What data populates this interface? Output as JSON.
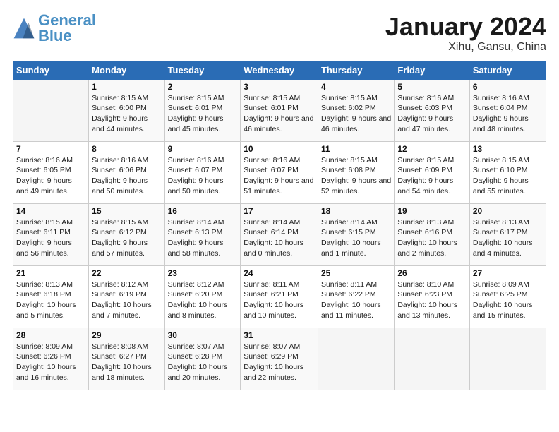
{
  "header": {
    "logo_text_general": "General",
    "logo_text_blue": "Blue",
    "month_title": "January 2024",
    "location": "Xihu, Gansu, China"
  },
  "weekdays": [
    "Sunday",
    "Monday",
    "Tuesday",
    "Wednesday",
    "Thursday",
    "Friday",
    "Saturday"
  ],
  "weeks": [
    [
      {
        "day": "",
        "sunrise": "",
        "sunset": "",
        "daylight": ""
      },
      {
        "day": "1",
        "sunrise": "Sunrise: 8:15 AM",
        "sunset": "Sunset: 6:00 PM",
        "daylight": "Daylight: 9 hours and 44 minutes."
      },
      {
        "day": "2",
        "sunrise": "Sunrise: 8:15 AM",
        "sunset": "Sunset: 6:01 PM",
        "daylight": "Daylight: 9 hours and 45 minutes."
      },
      {
        "day": "3",
        "sunrise": "Sunrise: 8:15 AM",
        "sunset": "Sunset: 6:01 PM",
        "daylight": "Daylight: 9 hours and 46 minutes."
      },
      {
        "day": "4",
        "sunrise": "Sunrise: 8:15 AM",
        "sunset": "Sunset: 6:02 PM",
        "daylight": "Daylight: 9 hours and 46 minutes."
      },
      {
        "day": "5",
        "sunrise": "Sunrise: 8:16 AM",
        "sunset": "Sunset: 6:03 PM",
        "daylight": "Daylight: 9 hours and 47 minutes."
      },
      {
        "day": "6",
        "sunrise": "Sunrise: 8:16 AM",
        "sunset": "Sunset: 6:04 PM",
        "daylight": "Daylight: 9 hours and 48 minutes."
      }
    ],
    [
      {
        "day": "7",
        "sunrise": "Sunrise: 8:16 AM",
        "sunset": "Sunset: 6:05 PM",
        "daylight": "Daylight: 9 hours and 49 minutes."
      },
      {
        "day": "8",
        "sunrise": "Sunrise: 8:16 AM",
        "sunset": "Sunset: 6:06 PM",
        "daylight": "Daylight: 9 hours and 50 minutes."
      },
      {
        "day": "9",
        "sunrise": "Sunrise: 8:16 AM",
        "sunset": "Sunset: 6:07 PM",
        "daylight": "Daylight: 9 hours and 50 minutes."
      },
      {
        "day": "10",
        "sunrise": "Sunrise: 8:16 AM",
        "sunset": "Sunset: 6:07 PM",
        "daylight": "Daylight: 9 hours and 51 minutes."
      },
      {
        "day": "11",
        "sunrise": "Sunrise: 8:15 AM",
        "sunset": "Sunset: 6:08 PM",
        "daylight": "Daylight: 9 hours and 52 minutes."
      },
      {
        "day": "12",
        "sunrise": "Sunrise: 8:15 AM",
        "sunset": "Sunset: 6:09 PM",
        "daylight": "Daylight: 9 hours and 54 minutes."
      },
      {
        "day": "13",
        "sunrise": "Sunrise: 8:15 AM",
        "sunset": "Sunset: 6:10 PM",
        "daylight": "Daylight: 9 hours and 55 minutes."
      }
    ],
    [
      {
        "day": "14",
        "sunrise": "Sunrise: 8:15 AM",
        "sunset": "Sunset: 6:11 PM",
        "daylight": "Daylight: 9 hours and 56 minutes."
      },
      {
        "day": "15",
        "sunrise": "Sunrise: 8:15 AM",
        "sunset": "Sunset: 6:12 PM",
        "daylight": "Daylight: 9 hours and 57 minutes."
      },
      {
        "day": "16",
        "sunrise": "Sunrise: 8:14 AM",
        "sunset": "Sunset: 6:13 PM",
        "daylight": "Daylight: 9 hours and 58 minutes."
      },
      {
        "day": "17",
        "sunrise": "Sunrise: 8:14 AM",
        "sunset": "Sunset: 6:14 PM",
        "daylight": "Daylight: 10 hours and 0 minutes."
      },
      {
        "day": "18",
        "sunrise": "Sunrise: 8:14 AM",
        "sunset": "Sunset: 6:15 PM",
        "daylight": "Daylight: 10 hours and 1 minute."
      },
      {
        "day": "19",
        "sunrise": "Sunrise: 8:13 AM",
        "sunset": "Sunset: 6:16 PM",
        "daylight": "Daylight: 10 hours and 2 minutes."
      },
      {
        "day": "20",
        "sunrise": "Sunrise: 8:13 AM",
        "sunset": "Sunset: 6:17 PM",
        "daylight": "Daylight: 10 hours and 4 minutes."
      }
    ],
    [
      {
        "day": "21",
        "sunrise": "Sunrise: 8:13 AM",
        "sunset": "Sunset: 6:18 PM",
        "daylight": "Daylight: 10 hours and 5 minutes."
      },
      {
        "day": "22",
        "sunrise": "Sunrise: 8:12 AM",
        "sunset": "Sunset: 6:19 PM",
        "daylight": "Daylight: 10 hours and 7 minutes."
      },
      {
        "day": "23",
        "sunrise": "Sunrise: 8:12 AM",
        "sunset": "Sunset: 6:20 PM",
        "daylight": "Daylight: 10 hours and 8 minutes."
      },
      {
        "day": "24",
        "sunrise": "Sunrise: 8:11 AM",
        "sunset": "Sunset: 6:21 PM",
        "daylight": "Daylight: 10 hours and 10 minutes."
      },
      {
        "day": "25",
        "sunrise": "Sunrise: 8:11 AM",
        "sunset": "Sunset: 6:22 PM",
        "daylight": "Daylight: 10 hours and 11 minutes."
      },
      {
        "day": "26",
        "sunrise": "Sunrise: 8:10 AM",
        "sunset": "Sunset: 6:23 PM",
        "daylight": "Daylight: 10 hours and 13 minutes."
      },
      {
        "day": "27",
        "sunrise": "Sunrise: 8:09 AM",
        "sunset": "Sunset: 6:25 PM",
        "daylight": "Daylight: 10 hours and 15 minutes."
      }
    ],
    [
      {
        "day": "28",
        "sunrise": "Sunrise: 8:09 AM",
        "sunset": "Sunset: 6:26 PM",
        "daylight": "Daylight: 10 hours and 16 minutes."
      },
      {
        "day": "29",
        "sunrise": "Sunrise: 8:08 AM",
        "sunset": "Sunset: 6:27 PM",
        "daylight": "Daylight: 10 hours and 18 minutes."
      },
      {
        "day": "30",
        "sunrise": "Sunrise: 8:07 AM",
        "sunset": "Sunset: 6:28 PM",
        "daylight": "Daylight: 10 hours and 20 minutes."
      },
      {
        "day": "31",
        "sunrise": "Sunrise: 8:07 AM",
        "sunset": "Sunset: 6:29 PM",
        "daylight": "Daylight: 10 hours and 22 minutes."
      },
      {
        "day": "",
        "sunrise": "",
        "sunset": "",
        "daylight": ""
      },
      {
        "day": "",
        "sunrise": "",
        "sunset": "",
        "daylight": ""
      },
      {
        "day": "",
        "sunrise": "",
        "sunset": "",
        "daylight": ""
      }
    ]
  ]
}
